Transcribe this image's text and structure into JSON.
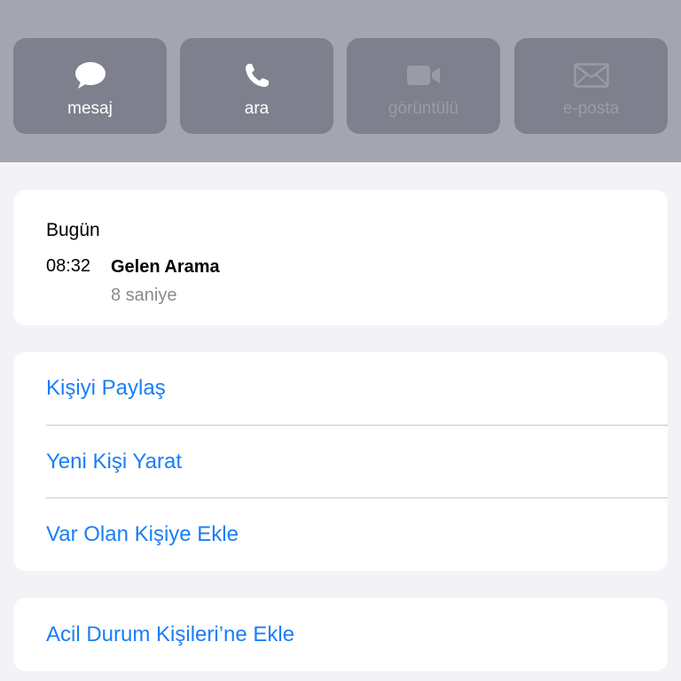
{
  "actions": [
    {
      "label": "mesaj",
      "icon": "message-icon",
      "enabled": true
    },
    {
      "label": "ara",
      "icon": "phone-icon",
      "enabled": true
    },
    {
      "label": "görüntülü",
      "icon": "video-icon",
      "enabled": false
    },
    {
      "label": "e-posta",
      "icon": "mail-icon",
      "enabled": false
    }
  ],
  "call_history": {
    "day": "Bugün",
    "time": "08:32",
    "type": "Gelen Arama",
    "duration": "8 saniye"
  },
  "contact_actions": {
    "share": "Kişiyi Paylaş",
    "create_new": "Yeni Kişi Yarat",
    "add_to_existing": "Var Olan Kişiye Ekle"
  },
  "emergency": {
    "add_label": "Acil Durum Kişileri’ne Ekle"
  },
  "colors": {
    "accent": "#1a7ef5",
    "header_bg": "#a4a5b1",
    "button_bg": "#7f808d",
    "background": "#f2f2f7"
  }
}
